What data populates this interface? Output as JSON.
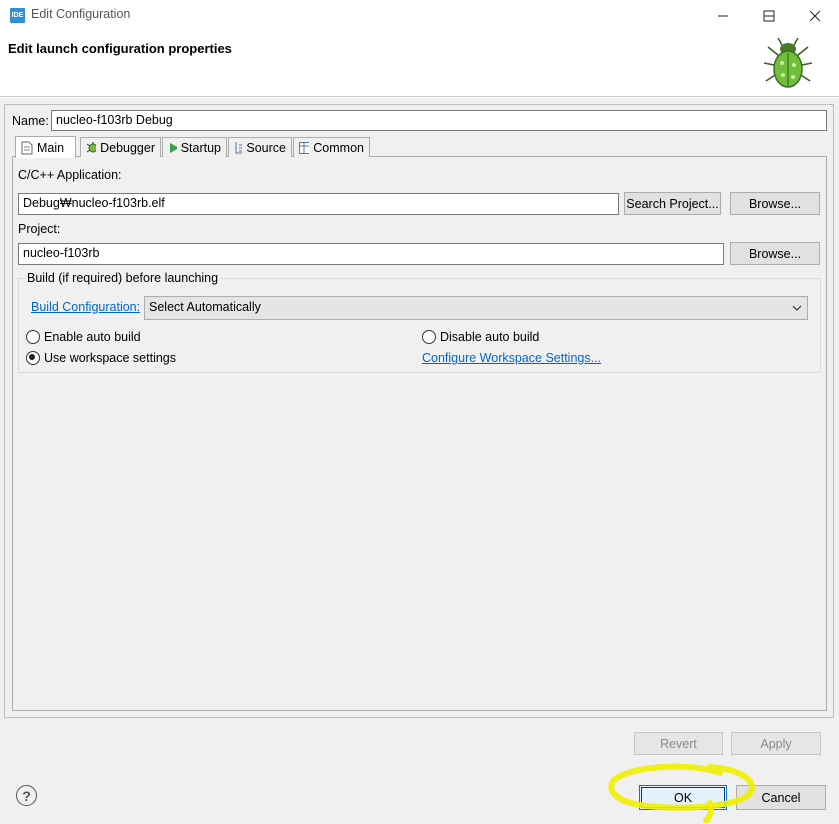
{
  "window": {
    "app_icon_text": "IDE",
    "title": "Edit Configuration"
  },
  "banner": {
    "title": "Edit launch configuration properties"
  },
  "name": {
    "label": "Name:",
    "value": "nucleo-f103rb Debug"
  },
  "tabs": [
    {
      "label": "Main",
      "icon": "document-icon",
      "active": true
    },
    {
      "label": "Debugger",
      "icon": "bug-gear-icon"
    },
    {
      "label": "Startup",
      "icon": "play-icon"
    },
    {
      "label": "Source",
      "icon": "source-lookup-icon"
    },
    {
      "label": "Common",
      "icon": "table-icon"
    }
  ],
  "main": {
    "app_label": "C/C++ Application:",
    "app_value": "Debug₩nucleo-f103rb.elf",
    "search_project": "Search Project...",
    "browse_app": "Browse...",
    "project_label": "Project:",
    "project_value": "nucleo-f103rb",
    "browse_project": "Browse...",
    "build": {
      "legend": "Build (if required) before launching",
      "config_link": "Build Configuration:",
      "config_value": "Select Automatically",
      "enable_auto": "Enable auto build",
      "disable_auto": "Disable auto build",
      "use_workspace": "Use workspace settings",
      "configure_link": "Configure Workspace Settings...",
      "selected": "use_workspace"
    }
  },
  "actions": {
    "revert": "Revert",
    "apply": "Apply",
    "ok": "OK",
    "cancel": "Cancel",
    "help": "?"
  },
  "colors": {
    "link": "#0066cc",
    "highlight": "#f0f000",
    "accent": "#0078d7"
  }
}
